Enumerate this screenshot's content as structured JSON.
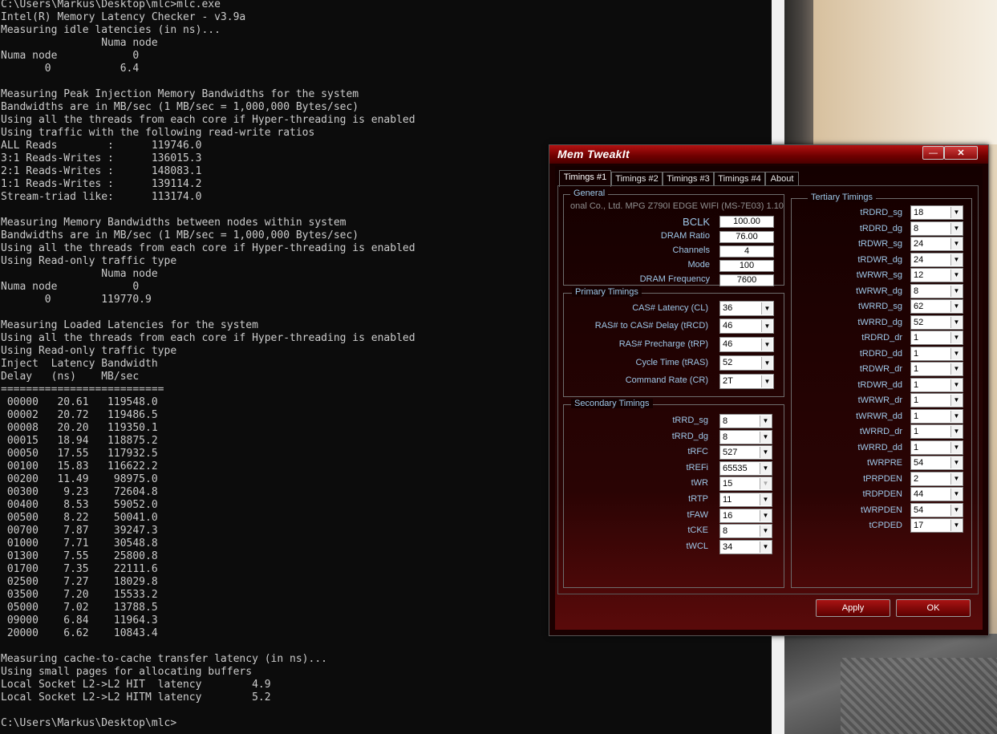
{
  "console": {
    "lines": [
      "C:\\Users\\Markus\\Desktop\\mlc>mlc.exe",
      "Intel(R) Memory Latency Checker - v3.9a",
      "Measuring idle latencies (in ns)...",
      "                Numa node",
      "Numa node            0",
      "       0           6.4",
      "",
      "Measuring Peak Injection Memory Bandwidths for the system",
      "Bandwidths are in MB/sec (1 MB/sec = 1,000,000 Bytes/sec)",
      "Using all the threads from each core if Hyper-threading is enabled",
      "Using traffic with the following read-write ratios",
      "ALL Reads        :      119746.0",
      "3:1 Reads-Writes :      136015.3",
      "2:1 Reads-Writes :      148083.1",
      "1:1 Reads-Writes :      139114.2",
      "Stream-triad like:      113174.0",
      "",
      "Measuring Memory Bandwidths between nodes within system",
      "Bandwidths are in MB/sec (1 MB/sec = 1,000,000 Bytes/sec)",
      "Using all the threads from each core if Hyper-threading is enabled",
      "Using Read-only traffic type",
      "                Numa node",
      "Numa node            0",
      "       0        119770.9",
      "",
      "Measuring Loaded Latencies for the system",
      "Using all the threads from each core if Hyper-threading is enabled",
      "Using Read-only traffic type",
      "Inject  Latency Bandwidth",
      "Delay   (ns)    MB/sec",
      "==========================",
      " 00000   20.61   119548.0",
      " 00002   20.72   119486.5",
      " 00008   20.20   119350.1",
      " 00015   18.94   118875.2",
      " 00050   17.55   117932.5",
      " 00100   15.83   116622.2",
      " 00200   11.49    98975.0",
      " 00300    9.23    72604.8",
      " 00400    8.53    59052.0",
      " 00500    8.22    50041.0",
      " 00700    7.87    39247.3",
      " 01000    7.71    30548.8",
      " 01300    7.55    25800.8",
      " 01700    7.35    22111.6",
      " 02500    7.27    18029.8",
      " 03500    7.20    15533.2",
      " 05000    7.02    13788.5",
      " 09000    6.84    11964.3",
      " 20000    6.62    10843.4",
      "",
      "Measuring cache-to-cache transfer latency (in ns)...",
      "Using small pages for allocating buffers",
      "Local Socket L2->L2 HIT  latency        4.9",
      "Local Socket L2->L2 HITM latency        5.2",
      "",
      "C:\\Users\\Markus\\Desktop\\mlc>"
    ]
  },
  "dialog": {
    "title": "Mem TweakIt",
    "min_label": "—",
    "close_label": "✕",
    "tabs": [
      "Timings #1",
      "Timings #2",
      "Timings #3",
      "Timings #4",
      "About"
    ],
    "apply_label": "Apply",
    "ok_label": "OK"
  },
  "general": {
    "title": "General",
    "board": "onal Co., Ltd. MPG Z790I EDGE WIFI (MS-7E03) 1.10",
    "bclk_label": "BCLK",
    "bclk": "100.00",
    "ratio_label": "DRAM Ratio",
    "ratio": "76.00",
    "channels_label": "Channels",
    "channels": "4",
    "mode_label": "Mode",
    "mode": "100",
    "freq_label": "DRAM Frequency",
    "freq": "7600"
  },
  "primary": {
    "title": "Primary Timings",
    "items": [
      {
        "label": "CAS# Latency (CL)",
        "value": "36"
      },
      {
        "label": "RAS# to CAS# Delay (tRCD)",
        "value": "46"
      },
      {
        "label": "RAS# Precharge (tRP)",
        "value": "46"
      },
      {
        "label": "Cycle Time (tRAS)",
        "value": "52"
      },
      {
        "label": "Command Rate (CR)",
        "value": "2T"
      }
    ]
  },
  "secondary": {
    "title": "Secondary Timings",
    "items": [
      {
        "label": "tRRD_sg",
        "value": "8"
      },
      {
        "label": "tRRD_dg",
        "value": "8"
      },
      {
        "label": "tRFC",
        "value": "527"
      },
      {
        "label": "tREFi",
        "value": "65535"
      },
      {
        "label": "tWR",
        "value": "15"
      },
      {
        "label": "tRTP",
        "value": "11"
      },
      {
        "label": "tFAW",
        "value": "16"
      },
      {
        "label": "tCKE",
        "value": "8"
      },
      {
        "label": "tWCL",
        "value": "34"
      }
    ]
  },
  "tertiary": {
    "title": "Tertiary Timings",
    "items": [
      {
        "label": "tRDRD_sg",
        "value": "18"
      },
      {
        "label": "tRDRD_dg",
        "value": "8"
      },
      {
        "label": "tRDWR_sg",
        "value": "24"
      },
      {
        "label": "tRDWR_dg",
        "value": "24"
      },
      {
        "label": "tWRWR_sg",
        "value": "12"
      },
      {
        "label": "tWRWR_dg",
        "value": "8"
      },
      {
        "label": "tWRRD_sg",
        "value": "62"
      },
      {
        "label": "tWRRD_dg",
        "value": "52"
      },
      {
        "label": "tRDRD_dr",
        "value": "1"
      },
      {
        "label": "tRDRD_dd",
        "value": "1"
      },
      {
        "label": "tRDWR_dr",
        "value": "1"
      },
      {
        "label": "tRDWR_dd",
        "value": "1"
      },
      {
        "label": "tWRWR_dr",
        "value": "1"
      },
      {
        "label": "tWRWR_dd",
        "value": "1"
      },
      {
        "label": "tWRRD_dr",
        "value": "1"
      },
      {
        "label": "tWRRD_dd",
        "value": "1"
      },
      {
        "label": "tWRPRE",
        "value": "54"
      },
      {
        "label": "tPRPDEN",
        "value": "2"
      },
      {
        "label": "tRDPDEN",
        "value": "44"
      },
      {
        "label": "tWRPDEN",
        "value": "54"
      },
      {
        "label": "tCPDED",
        "value": "17"
      }
    ]
  },
  "icons": {
    "dropdown": "chevron-down-icon"
  }
}
